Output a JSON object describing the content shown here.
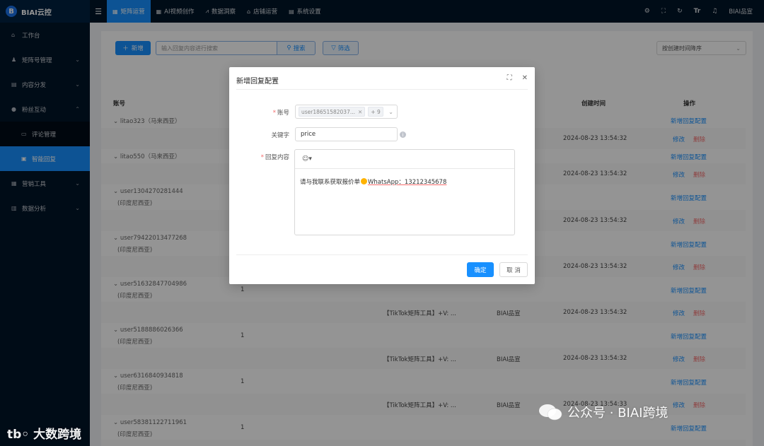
{
  "app": {
    "brand": "BIAI云控",
    "user": "BIAI品宣"
  },
  "sidebar": {
    "items": [
      {
        "label": "工作台",
        "icon": "home-icon"
      },
      {
        "label": "矩阵号管理",
        "icon": "users-icon"
      },
      {
        "label": "内容分发",
        "icon": "share-icon"
      },
      {
        "label": "粉丝互动",
        "icon": "chat-icon"
      },
      {
        "label": "评论管理",
        "icon": "comment-icon"
      },
      {
        "label": "智能回复",
        "icon": "robot-icon"
      },
      {
        "label": "营销工具",
        "icon": "toolbox-icon"
      },
      {
        "label": "数据分析",
        "icon": "bar-chart-icon"
      }
    ]
  },
  "topnav": {
    "tabs": [
      {
        "label": "矩阵运营",
        "icon": "grid-icon"
      },
      {
        "label": "AI视频创作",
        "icon": "apps-icon"
      },
      {
        "label": "数据洞察",
        "icon": "trend-icon"
      },
      {
        "label": "店铺运营",
        "icon": "shop-icon"
      },
      {
        "label": "系统设置",
        "icon": "doc-icon"
      }
    ],
    "right_icons": [
      "settings-icon",
      "fullscreen-icon",
      "refresh-icon",
      "font-size-icon",
      "bell-icon"
    ]
  },
  "toolbar": {
    "new_label": "新增",
    "search_placeholder": "输入回复内容进行搜索",
    "search_label": "搜索",
    "filter_label": "筛选",
    "sort_value": "按创建时间降序"
  },
  "table": {
    "headers": {
      "account": "账号",
      "created": "创建时间",
      "actions": "操作"
    },
    "accounts": [
      {
        "name": "litao323（马来西亚）",
        "region": ""
      },
      {
        "name": "litao550（马来西亚）",
        "region": ""
      },
      {
        "name": "user1304270281444",
        "region": "(印度尼西亚)"
      },
      {
        "name": "user79422013477268",
        "region": "(印度尼西亚)"
      },
      {
        "name": "user51632847704986",
        "region": "(印度尼西亚)",
        "count": "1"
      },
      {
        "name": "user5188886026366",
        "region": "(印度尼西亚)",
        "count": "1"
      },
      {
        "name": "user6316840934818",
        "region": "(印度尼西亚)",
        "count": "1"
      },
      {
        "name": "user58381122711961",
        "region": "(印度尼西亚)",
        "count": "1"
      }
    ],
    "sub_rows": [
      {
        "content": "",
        "creator": "",
        "time": "2024-08-23 13:54:32"
      },
      {
        "content": "",
        "creator": "",
        "time": "2024-08-23 13:54:32"
      },
      {
        "content": "",
        "creator": "",
        "time": "2024-08-23 13:54:32"
      },
      {
        "content": "",
        "creator": "",
        "time": "2024-08-23 13:54:32"
      },
      {
        "content": "【TikTok矩阵工具】+V: ...",
        "creator": "BIAI品宣",
        "time": "2024-08-23 13:54:32"
      },
      {
        "content": "【TikTok矩阵工具】+V: ...",
        "creator": "BIAI品宣",
        "time": "2024-08-23 13:54:32"
      },
      {
        "content": "【TikTok矩阵工具】+V: ...",
        "creator": "BIAI品宣",
        "time": "2024-08-23 13:54:33"
      }
    ],
    "add_config_label": "新增回复配置",
    "edit_label": "修改",
    "delete_label": "删除"
  },
  "dialog": {
    "title": "新增回复配置",
    "account_label": "账号",
    "account_tag": "user18651582037...",
    "account_more": "+ 9",
    "keyword_label": "关键字",
    "keyword_value": "price",
    "content_label": "回复内容",
    "content_prefix": "请与我联系获取报价单",
    "content_wa": "WhatsApp：13212345678",
    "ok_label": "确定",
    "cancel_label": "取 消"
  },
  "watermark": {
    "left": "大数跨境",
    "right": "公众号 · BIAI跨境"
  },
  "colors": {
    "primary": "#1890ff",
    "sidebar": "#001529",
    "danger": "#f56c6c"
  }
}
